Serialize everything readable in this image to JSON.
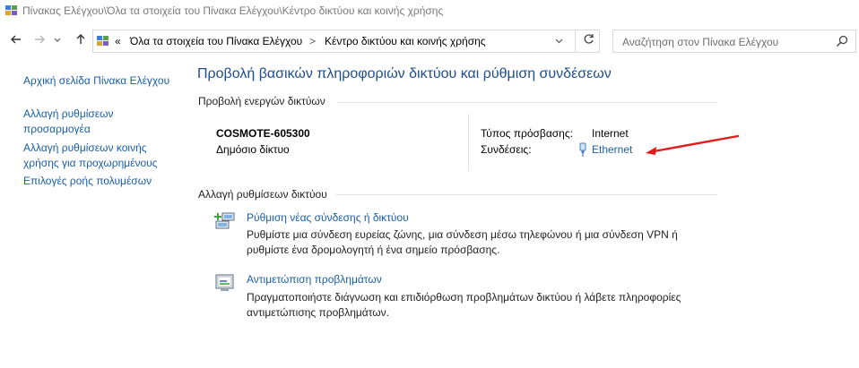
{
  "window": {
    "title": "Πίνακας Ελέγχου\\Όλα τα στοιχεία του Πίνακα Ελέγχου\\Κέντρο δικτύου και κοινής χρήσης"
  },
  "address": {
    "overflow": "«",
    "crumbs": [
      "Όλα τα στοιχεία του Πίνακα Ελέγχου",
      "Κέντρο δικτύου και κοινής χρήσης"
    ],
    "separator": ">"
  },
  "search": {
    "placeholder": "Αναζήτηση στον Πίνακα Ελέγχου"
  },
  "sidebar": {
    "home": "Αρχική σελίδα Πίνακα Ελέγχου",
    "adapter_1": "Αλλαγή ρυθμίσεων",
    "adapter_2": "προσαρμογέα",
    "sharing_1": "Αλλαγή ρυθμίσεων κοινής",
    "sharing_2": "χρήσης για προχωρημένους",
    "media": "Επιλογές ροής πολυμέσων"
  },
  "main": {
    "title": "Προβολή βασικών πληροφοριών δικτύου και ρύθμιση συνδέσεων",
    "active_label": "Προβολή ενεργών δικτύων",
    "network": {
      "name": "COSMOTE-605300",
      "category": "Δημόσιο δίκτυο",
      "access_label": "Τύπος πρόσβασης:",
      "access_value": "Internet",
      "connections_label": "Συνδέσεις:",
      "connection_value": "Ethernet"
    },
    "change_label": "Αλλαγή ρυθμίσεων δικτύου",
    "tasks": [
      {
        "title": "Ρύθμιση νέας σύνδεσης ή δικτύου",
        "desc_1": "Ρυθμίστε μια σύνδεση ευρείας ζώνης, μια σύνδεση μέσω τηλεφώνου ή μια σύνδεση VPN ή",
        "desc_2": "ρυθμίστε ένα δρομολογητή ή ένα σημείο πρόσβασης."
      },
      {
        "title": "Αντιμετώπιση προβλημάτων",
        "desc_1": "Πραγματοποιήστε διάγνωση και επιδιόρθωση προβλημάτων δικτύου ή λάβετε πληροφορίες",
        "desc_2": "αντιμετώπισης προβλημάτων."
      }
    ]
  },
  "colors": {
    "link": "#1a5ea8",
    "heading": "#1e4e8c",
    "annotation_arrow": "#e21b1b"
  }
}
